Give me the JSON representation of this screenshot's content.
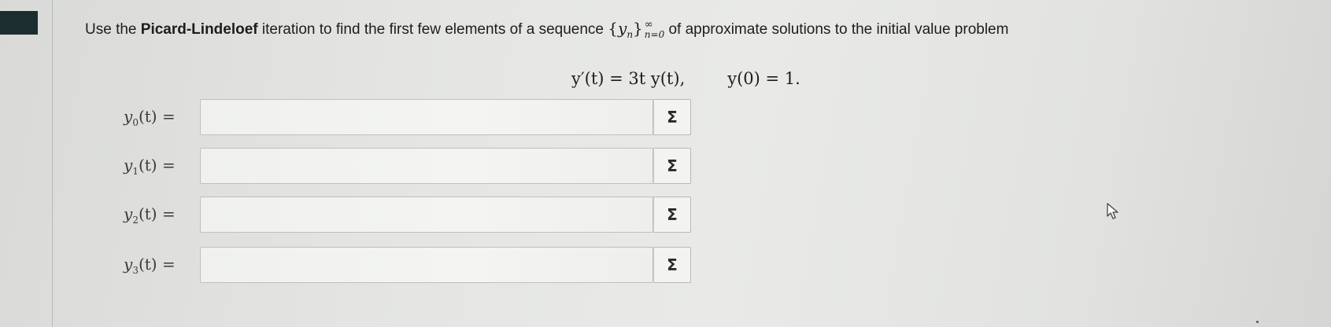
{
  "prompt": {
    "before": "Use the ",
    "bold": "Picard-Lindeloef",
    "middle": " iteration to find the first few elements of a sequence ",
    "seq_var": "y",
    "seq_sub": "n",
    "seq_sup": "∞",
    "seq_lower": "n=0",
    "after": " of approximate solutions to the initial value problem"
  },
  "equation": {
    "ode": "y′(t) = 3t y(t),",
    "initial": "y(0) = 1."
  },
  "rows": [
    {
      "var": "y",
      "sub": "0",
      "rest": "(t) =",
      "value": "",
      "button": "Σ"
    },
    {
      "var": "y",
      "sub": "1",
      "rest": "(t) =",
      "value": "",
      "button": "Σ"
    },
    {
      "var": "y",
      "sub": "2",
      "rest": "(t) =",
      "value": "",
      "button": "Σ"
    },
    {
      "var": "y",
      "sub": "3",
      "rest": "(t) =",
      "value": "",
      "button": "Σ"
    }
  ],
  "icons": {
    "cursor": "mouse-pointer-icon",
    "sigma": "sigma-icon"
  },
  "colors": {
    "corner_block": "#1c2d2f",
    "background": "#e4e5e3"
  }
}
